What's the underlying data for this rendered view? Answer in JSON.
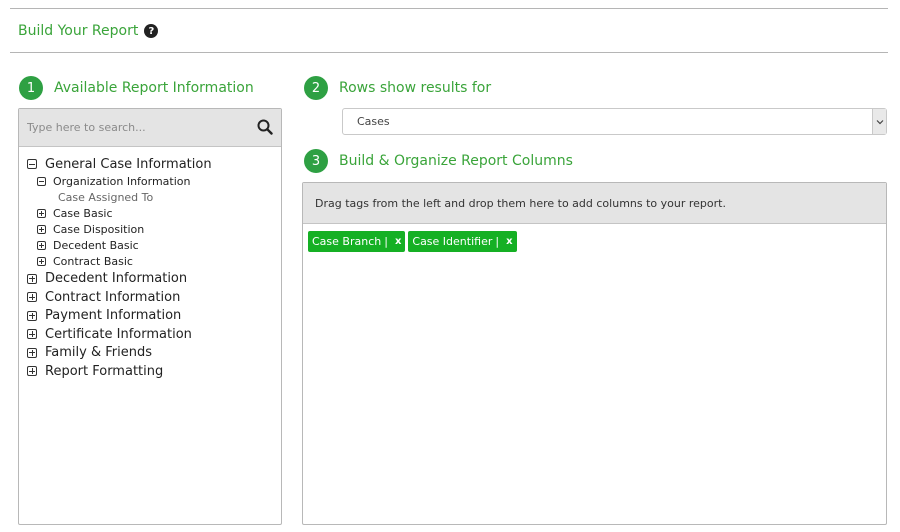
{
  "header": {
    "title": "Build Your Report",
    "help_icon": "question-circle-icon"
  },
  "steps": [
    {
      "number": "1",
      "label": "Available Report Information"
    },
    {
      "number": "2",
      "label": "Rows show results for"
    },
    {
      "number": "3",
      "label": "Build & Organize Report Columns"
    }
  ],
  "search": {
    "placeholder": "Type here to search...",
    "value": "",
    "icon": "search-icon"
  },
  "tree": {
    "general": {
      "label": "General Case Information",
      "expanded": true,
      "children": {
        "organization": {
          "label": "Organization Information",
          "expanded": true,
          "children": [
            "Case Assigned To"
          ]
        },
        "case_basic": {
          "label": "Case Basic",
          "expanded": false
        },
        "case_disposition": {
          "label": "Case Disposition",
          "expanded": false
        },
        "decedent_basic": {
          "label": "Decedent Basic",
          "expanded": false
        },
        "contract_basic": {
          "label": "Contract Basic",
          "expanded": false
        }
      }
    },
    "others": [
      {
        "label": "Decedent Information",
        "expanded": false
      },
      {
        "label": "Contract Information",
        "expanded": false
      },
      {
        "label": "Payment Information",
        "expanded": false
      },
      {
        "label": "Certificate Information",
        "expanded": false
      },
      {
        "label": "Family & Friends",
        "expanded": false
      },
      {
        "label": "Report Formatting",
        "expanded": false
      }
    ]
  },
  "rows_select": {
    "selected": "Cases"
  },
  "columns": {
    "instructions": "Drag tags from the left and drop them here to add columns to your report.",
    "tags": [
      {
        "label": "Case Branch",
        "separator": "|",
        "remove": "x"
      },
      {
        "label": "Case Identifier",
        "separator": "|",
        "remove": "x"
      }
    ]
  },
  "colors": {
    "accent_green": "#3aa43a",
    "step_badge": "#2ea043",
    "tag_green": "#15b024",
    "panel_header": "#e4e4e4"
  }
}
